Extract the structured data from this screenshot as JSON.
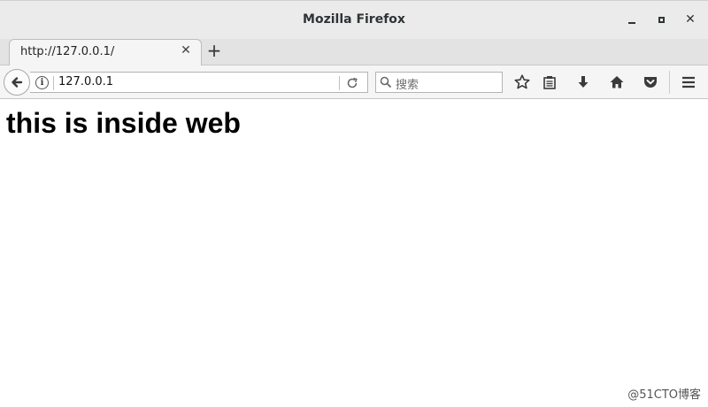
{
  "window": {
    "title": "Mozilla Firefox",
    "controls": {
      "minimize": "minimize",
      "maximize": "maximize",
      "close": "✕"
    }
  },
  "tabs": [
    {
      "label": "http://127.0.0.1/",
      "close": "✕"
    }
  ],
  "newtab_label": "+",
  "navbar": {
    "url": "127.0.0.1",
    "search_placeholder": "搜索",
    "icons": [
      "back-icon",
      "info-icon",
      "reload-icon",
      "search-icon",
      "star-icon",
      "reader-icon",
      "download-icon",
      "home-icon",
      "pocket-icon",
      "menu-icon"
    ]
  },
  "page": {
    "heading": "this is inside web"
  },
  "watermark": "@51CTO博客"
}
